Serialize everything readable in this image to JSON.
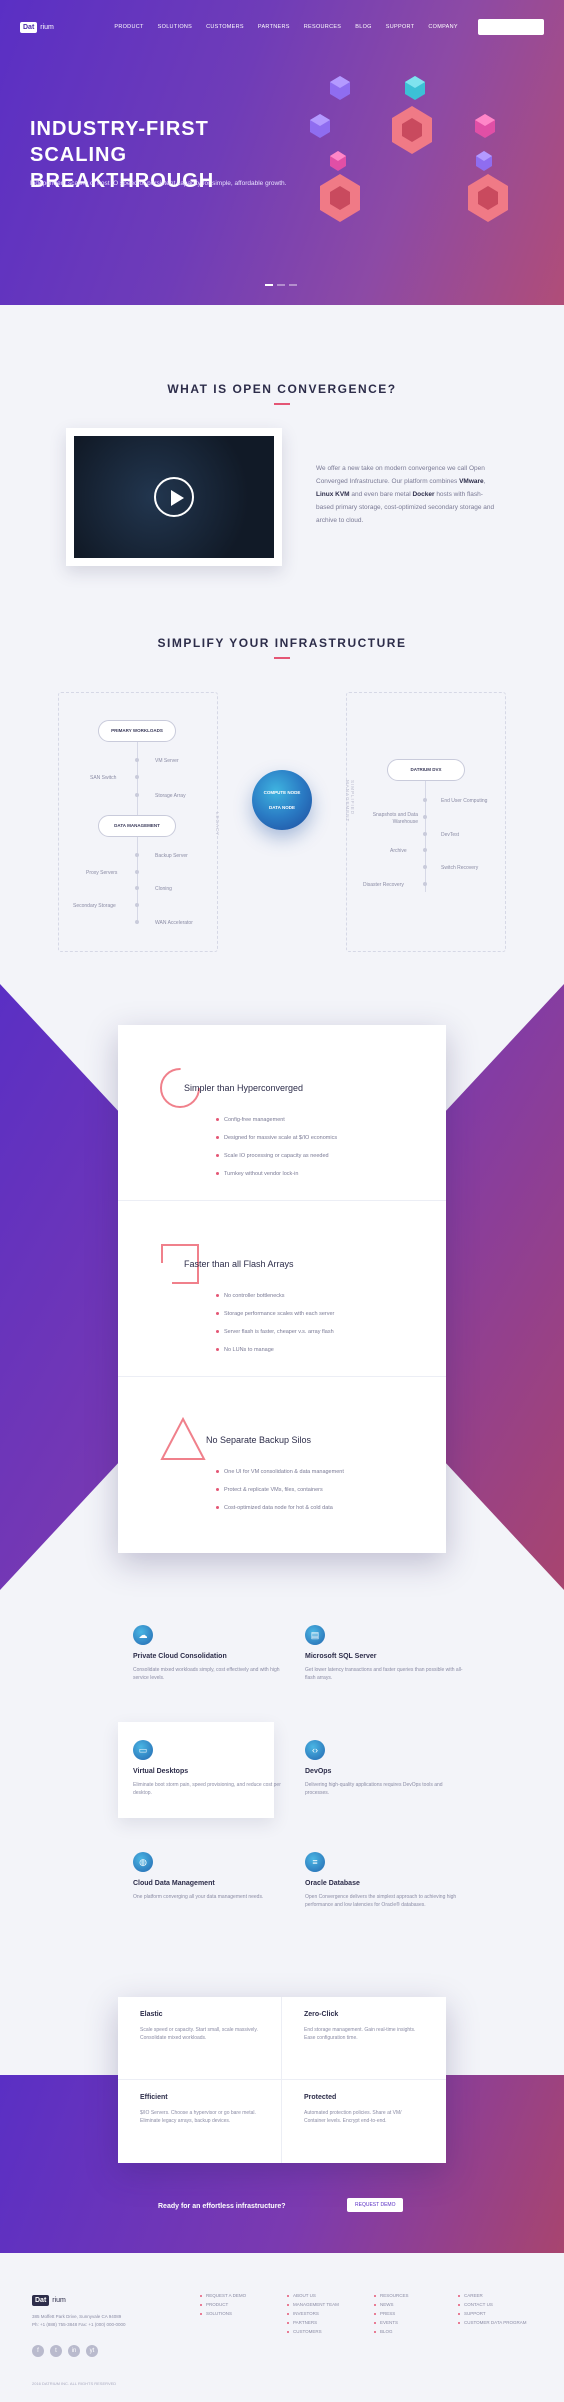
{
  "nav": {
    "logo_box": "Dat",
    "logo_text": "rium",
    "links": [
      "PRODUCT",
      "SOLUTIONS",
      "CUSTOMERS",
      "PARTNERS",
      "RESOURCES",
      "BLOG",
      "SUPPORT",
      "COMPANY"
    ],
    "cta": "REQUEST DEMO"
  },
  "hero": {
    "title_line1": "INDUSTRY-FIRST",
    "title_line2": "SCALING BREAKTHROUGH",
    "subtitle": "Independent scaling of host IO speed or persistent capacity for simple, affordable growth."
  },
  "open_convergence": {
    "title": "WHAT IS OPEN CONVERGENCE?",
    "text_part1": "We offer a new take on modern convergence we call Open Converged Infrastructure. Our platform combines ",
    "bold1": "VMware",
    "text_part2": ", ",
    "bold2": "Linux KVM",
    "text_part3": " and even bare metal ",
    "bold3": "Docker",
    "text_part4": " hosts with flash-based primary storage, cost-optimized secondary storage and archive to cloud."
  },
  "simplify": {
    "title": "SIMPLIFY YOUR INFRASTRUCTURE",
    "left_label": "LEGACY",
    "right_label": "SIMPLIFIED MANAGEMENT",
    "primary_workloads": "PRIMARY WORKLOADS",
    "data_management": "DATA MANAGEMENT",
    "datrium_dvx": "DATRIUM DVX",
    "compute_node": "COMPUTE NODE",
    "data_node": "DATA NODE",
    "left_items": [
      "SAN Switch",
      "Proxy Servers",
      "Secondary Storage"
    ],
    "mid_items": [
      "VM Server",
      "Storage Array",
      "Backup Server",
      "Cloning",
      "WAN Accelerator"
    ],
    "right_left_items": [
      "Snapshots and Data Warehouse",
      "Archive",
      "Disaster Recovery"
    ],
    "right_right_items": [
      "End User Computing",
      "DevTest",
      "Switch Recovery"
    ]
  },
  "features": [
    {
      "title": "Simpler than Hyperconverged",
      "items": [
        "Config-free management",
        "Designed for massive scale at $/IO economics",
        "Scale IO processing or capacity as needed",
        "Turnkey without vendor lock-in"
      ]
    },
    {
      "title": "Faster than all Flash Arrays",
      "items": [
        "No controller bottlenecks",
        "Storage performance scales with each server",
        "Server flash is faster, cheaper v.s. array flash",
        "No LUNs to manage"
      ]
    },
    {
      "title": "No Separate Backup Silos",
      "items": [
        "One UI for VM consolidation & data management",
        "Protect & replicate VMs, files, containers",
        "Cost-optimized data node for hot & cold data"
      ]
    }
  ],
  "use_cases": [
    {
      "icon": "cloud-icon",
      "glyph": "☁",
      "title": "Private Cloud Consolidation",
      "desc": "Consolidate mixed workloads simply, cost effectively and with high service levels."
    },
    {
      "icon": "database-icon",
      "glyph": "▤",
      "title": "Microsoft SQL Server",
      "desc": "Get lower latency transactions and faster queries than possible with all-flash arrays."
    },
    {
      "icon": "desktop-icon",
      "glyph": "▭",
      "title": "Virtual Desktops",
      "desc": "Eliminate boot storm pain, speed provisioning, and reduce cost per desktop."
    },
    {
      "icon": "code-icon",
      "glyph": "‹›",
      "title": "DevOps",
      "desc": "Delivering high-quality applications requires DevOps tools and processes."
    },
    {
      "icon": "globe-icon",
      "glyph": "◍",
      "title": "Cloud Data Management",
      "desc": "One platform converging all your data management needs."
    },
    {
      "icon": "cylinder-icon",
      "glyph": "≡",
      "title": "Oracle Database",
      "desc": "Open Convergence delivers the simplest approach to achieving high performance and low latencies for Oracle® databases."
    }
  ],
  "benefits": [
    {
      "title": "Elastic",
      "desc": "Scale speed or capacity. Start small, scale massively. Consolidate mixed workloads."
    },
    {
      "title": "Zero-Click",
      "desc": "End storage management. Gain real-time insights. Ease configuration time."
    },
    {
      "title": "Efficient",
      "desc": "$/IO Servers. Choose a hypervisor or go bare metal. Eliminate legacy arrays, backup devices."
    },
    {
      "title": "Protected",
      "desc": "Automated protection policies. Share at VM/ Container levels. Encrypt end-to-end."
    }
  ],
  "cta": {
    "text": "Ready for an effortless infrastructure?",
    "button": "REQUEST DEMO"
  },
  "footer": {
    "logo_box": "Dat",
    "logo_text": "rium",
    "address1": "385 Moffett Park Drive, Sunnyvale CA 94089",
    "address2": "Ph: +1 (888) 755-3848  Fax: +1 (000) 000-0000",
    "col1": [
      "REQUEST A DEMO",
      "PRODUCT",
      "SOLUTIONS"
    ],
    "col2": [
      "ABOUT US",
      "MANAGEMENT TEAM",
      "INVESTORS",
      "PARTNERS",
      "CUSTOMERS"
    ],
    "col3": [
      "RESOURCES",
      "NEWS",
      "PRESS",
      "EVENTS",
      "BLOG"
    ],
    "col4": [
      "CAREER",
      "CONTACT US",
      "SUPPORT",
      "CUSTOMER DATA PROGRAM"
    ],
    "social": [
      "f",
      "t",
      "in",
      "yt"
    ],
    "copyright": "2016 DATRIUM INC. ALL RIGHTS RESERVED"
  }
}
